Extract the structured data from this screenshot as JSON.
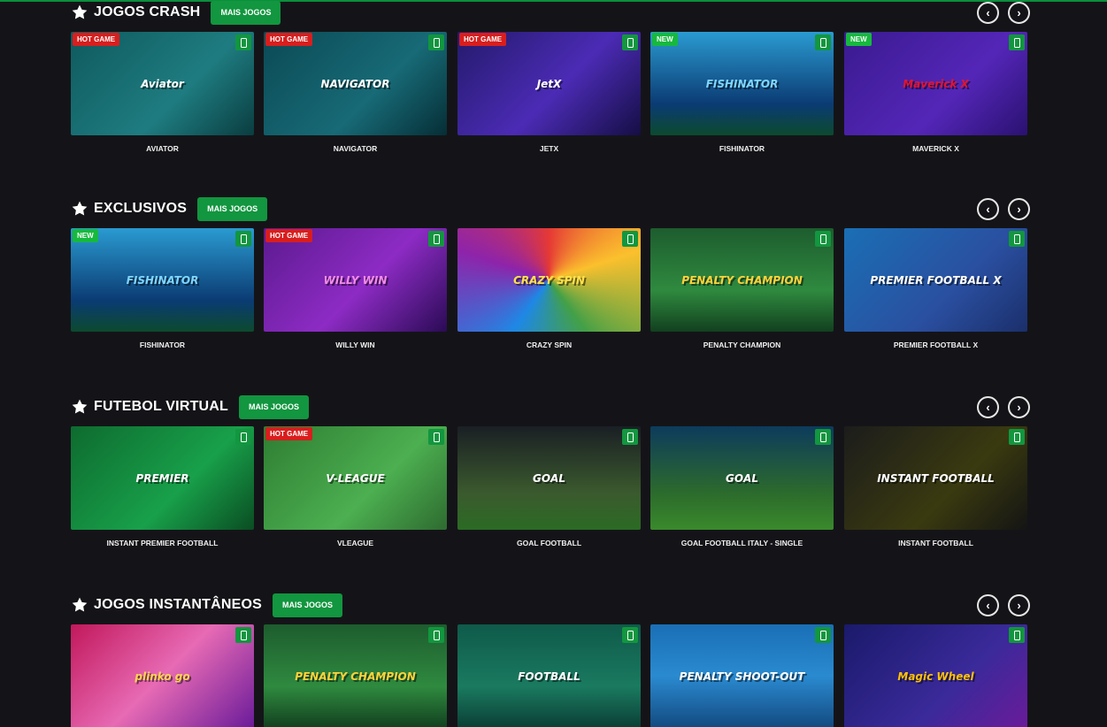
{
  "sections": [
    {
      "title": "JOGOS CRASH",
      "more_label": "MAIS JOGOS",
      "games": [
        {
          "name": "AVIATOR",
          "badge": "HOT GAME",
          "art": "Aviator",
          "bg": "linear-gradient(135deg,#0f5a5e,#1e7c80 60%,#0a3d40)",
          "art_color": "#ffffff"
        },
        {
          "name": "NAVIGATOR",
          "badge": "HOT GAME",
          "art": "NAVIGATOR",
          "bg": "linear-gradient(135deg,#0b4a55,#176a76 60%,#062e36)",
          "art_color": "#ffffff"
        },
        {
          "name": "JETX",
          "badge": "HOT GAME",
          "art": "JetX",
          "bg": "linear-gradient(135deg,#241a6b,#4b2bb5 55%,#150e44)",
          "art_color": "#ffffff"
        },
        {
          "name": "FISHINATOR",
          "badge": "NEW",
          "art": "FISHINATOR",
          "bg": "linear-gradient(180deg,#2a9bd1,#0b3b73 70%,#0c4a2e)",
          "art_color": "#7fd6ff"
        },
        {
          "name": "MAVERICK X",
          "badge": "NEW",
          "art": "Maverick X",
          "bg": "linear-gradient(135deg,#3a1a8f,#5426b8 60%,#2a1170)",
          "art_color": "#e3142c"
        }
      ]
    },
    {
      "title": "EXCLUSIVOS",
      "more_label": "MAIS JOGOS",
      "games": [
        {
          "name": "FISHINATOR",
          "badge": "NEW",
          "art": "FISHINATOR",
          "bg": "linear-gradient(180deg,#2a9bd1,#0b3b73 70%,#0c4a2e)",
          "art_color": "#7fd6ff"
        },
        {
          "name": "WILLY WIN",
          "badge": "HOT GAME",
          "art": "WILLY WIN",
          "bg": "linear-gradient(135deg,#5b1a8f,#8d2bc4 55%,#2a0b55)",
          "art_color": "#f28ce6"
        },
        {
          "name": "CRAZY SPIN",
          "badge": "",
          "art": "CRAZY SPIN",
          "bg": "conic-gradient(#e53935,#fbc02d,#43a047,#1e88e5,#8e24aa,#e53935)",
          "art_color": "#ffe14a"
        },
        {
          "name": "PENALTY CHAMPION",
          "badge": "",
          "art": "PENALTY CHAMPION",
          "bg": "linear-gradient(180deg,#1d5c2e,#2f8a3f 60%,#12401f)",
          "art_color": "#ffd23a"
        },
        {
          "name": "PREMIER FOOTBALL X",
          "badge": "",
          "art": "PREMIER FOOTBALL X",
          "bg": "linear-gradient(135deg,#1a6fb5,#2a4fa0 60%,#1b2f6b)",
          "art_color": "#ffffff"
        }
      ]
    },
    {
      "title": "FUTEBOL VIRTUAL",
      "more_label": "MAIS JOGOS",
      "games": [
        {
          "name": "INSTANT PREMIER FOOTBALL",
          "badge": "",
          "art": "PREMIER",
          "bg": "linear-gradient(135deg,#0e6b2f,#18a04a 60%,#0a4d22)",
          "art_color": "#ffffff"
        },
        {
          "name": "VLEAGUE",
          "badge": "HOT GAME",
          "art": "V-LEAGUE",
          "bg": "linear-gradient(135deg,#2e7d32,#4caf50 60%,#2e6b30)",
          "art_color": "#ffffff"
        },
        {
          "name": "GOAL FOOTBALL",
          "badge": "",
          "art": "GOAL",
          "bg": "linear-gradient(180deg,#1a1f24,#3b5a2e 65%,#2b6b24)",
          "art_color": "#ffffff"
        },
        {
          "name": "GOAL FOOTBALL ITALY - SINGLE",
          "badge": "",
          "art": "GOAL",
          "bg": "linear-gradient(180deg,#0d3b5c,#2c6b2c 65%,#3a8a2c)",
          "art_color": "#ffffff"
        },
        {
          "name": "INSTANT FOOTBALL",
          "badge": "",
          "art": "INSTANT FOOTBALL",
          "bg": "linear-gradient(135deg,#1c1c1c,#3a3a10 60%,#141414)",
          "art_color": "#ffffff"
        }
      ]
    },
    {
      "title": "JOGOS INSTANTÂNEOS",
      "more_label": "MAIS JOGOS",
      "games": [
        {
          "name": "",
          "badge": "",
          "art": "plinko go",
          "bg": "linear-gradient(135deg,#c2185b,#e76ab4 50%,#6a1b9a)",
          "art_color": "#ffd54f"
        },
        {
          "name": "",
          "badge": "",
          "art": "PENALTY CHAMPION",
          "bg": "linear-gradient(180deg,#1d5c2e,#2f8a3f 60%,#12401f)",
          "art_color": "#ffd23a"
        },
        {
          "name": "",
          "badge": "",
          "art": "FOOTBALL",
          "bg": "linear-gradient(180deg,#0f5a4a,#1a7a60 60%,#0b3f35)",
          "art_color": "#ffffff"
        },
        {
          "name": "",
          "badge": "",
          "art": "PENALTY SHOOT-OUT",
          "bg": "linear-gradient(180deg,#1a6fb5,#2a8ad0 50%,#134a80)",
          "art_color": "#ffffff"
        },
        {
          "name": "",
          "badge": "",
          "art": "Magic Wheel",
          "bg": "linear-gradient(135deg,#1a1a6b,#3a2a9a 60%,#6a1b9a)",
          "art_color": "#ffc107"
        }
      ]
    }
  ]
}
